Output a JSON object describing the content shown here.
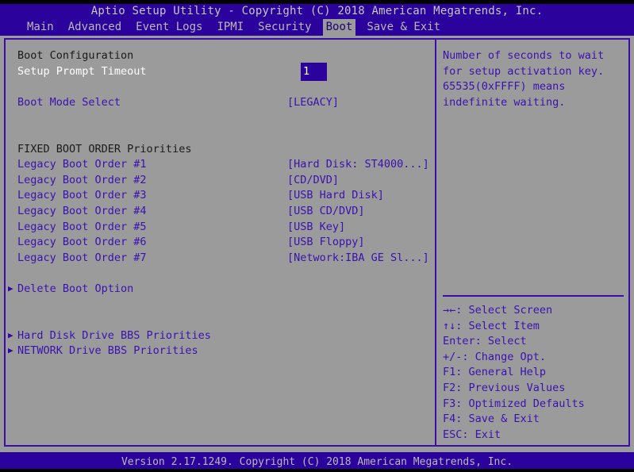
{
  "header": {
    "title": "Aptio Setup Utility - Copyright (C) 2018 American Megatrends, Inc.",
    "menu": [
      {
        "label": "Main",
        "active": false
      },
      {
        "label": "Advanced",
        "active": false
      },
      {
        "label": "Event Logs",
        "active": false
      },
      {
        "label": "IPMI",
        "active": false
      },
      {
        "label": "Security",
        "active": false
      },
      {
        "label": "Boot",
        "active": true
      },
      {
        "label": "Save & Exit",
        "active": false
      }
    ]
  },
  "main": {
    "section_boot_configuration": "Boot Configuration",
    "setup_prompt_timeout_label": "Setup Prompt Timeout",
    "setup_prompt_timeout_value": "1",
    "boot_mode_select_label": "Boot Mode Select",
    "boot_mode_select_value": "[LEGACY]",
    "section_fixed_boot_order": "FIXED BOOT ORDER Priorities",
    "boot_order": [
      {
        "label": "Legacy Boot Order #1",
        "value": "[Hard Disk: ST4000...]"
      },
      {
        "label": "Legacy Boot Order #2",
        "value": "[CD/DVD]"
      },
      {
        "label": "Legacy Boot Order #3",
        "value": "[USB Hard Disk]"
      },
      {
        "label": "Legacy Boot Order #4",
        "value": "[USB CD/DVD]"
      },
      {
        "label": "Legacy Boot Order #5",
        "value": "[USB Key]"
      },
      {
        "label": "Legacy Boot Order #6",
        "value": "[USB Floppy]"
      },
      {
        "label": "Legacy Boot Order #7",
        "value": "[Network:IBA GE Sl...]"
      }
    ],
    "submenus_group1": [
      {
        "label": "Delete Boot Option",
        "arrow": "▶"
      }
    ],
    "submenus_group2": [
      {
        "label": "Hard Disk Drive BBS Priorities",
        "arrow": "▶"
      },
      {
        "label": "NETWORK Drive BBS Priorities",
        "arrow": "▶"
      }
    ]
  },
  "help": {
    "lines": [
      "Number of seconds to wait",
      "for setup activation key.",
      "65535(0xFFFF) means",
      "indefinite waiting."
    ]
  },
  "keys": {
    "lines": [
      "→←: Select Screen",
      "↑↓: Select Item",
      "Enter: Select",
      "+/-: Change Opt.",
      "F1: General Help",
      "F2: Previous Values",
      "F3: Optimized Defaults",
      "F4: Save & Exit",
      "ESC: Exit"
    ]
  },
  "footer": {
    "text": "Version 2.17.1249. Copyright (C) 2018 American Megatrends, Inc."
  },
  "colors": {
    "background": "#9b9b9b",
    "accent_blue": "#2b039c",
    "border_blue": "#3c0da8",
    "item_text": "#3a12b0",
    "header_text": "#b9b9b9",
    "selected_text": "#ffffff"
  }
}
